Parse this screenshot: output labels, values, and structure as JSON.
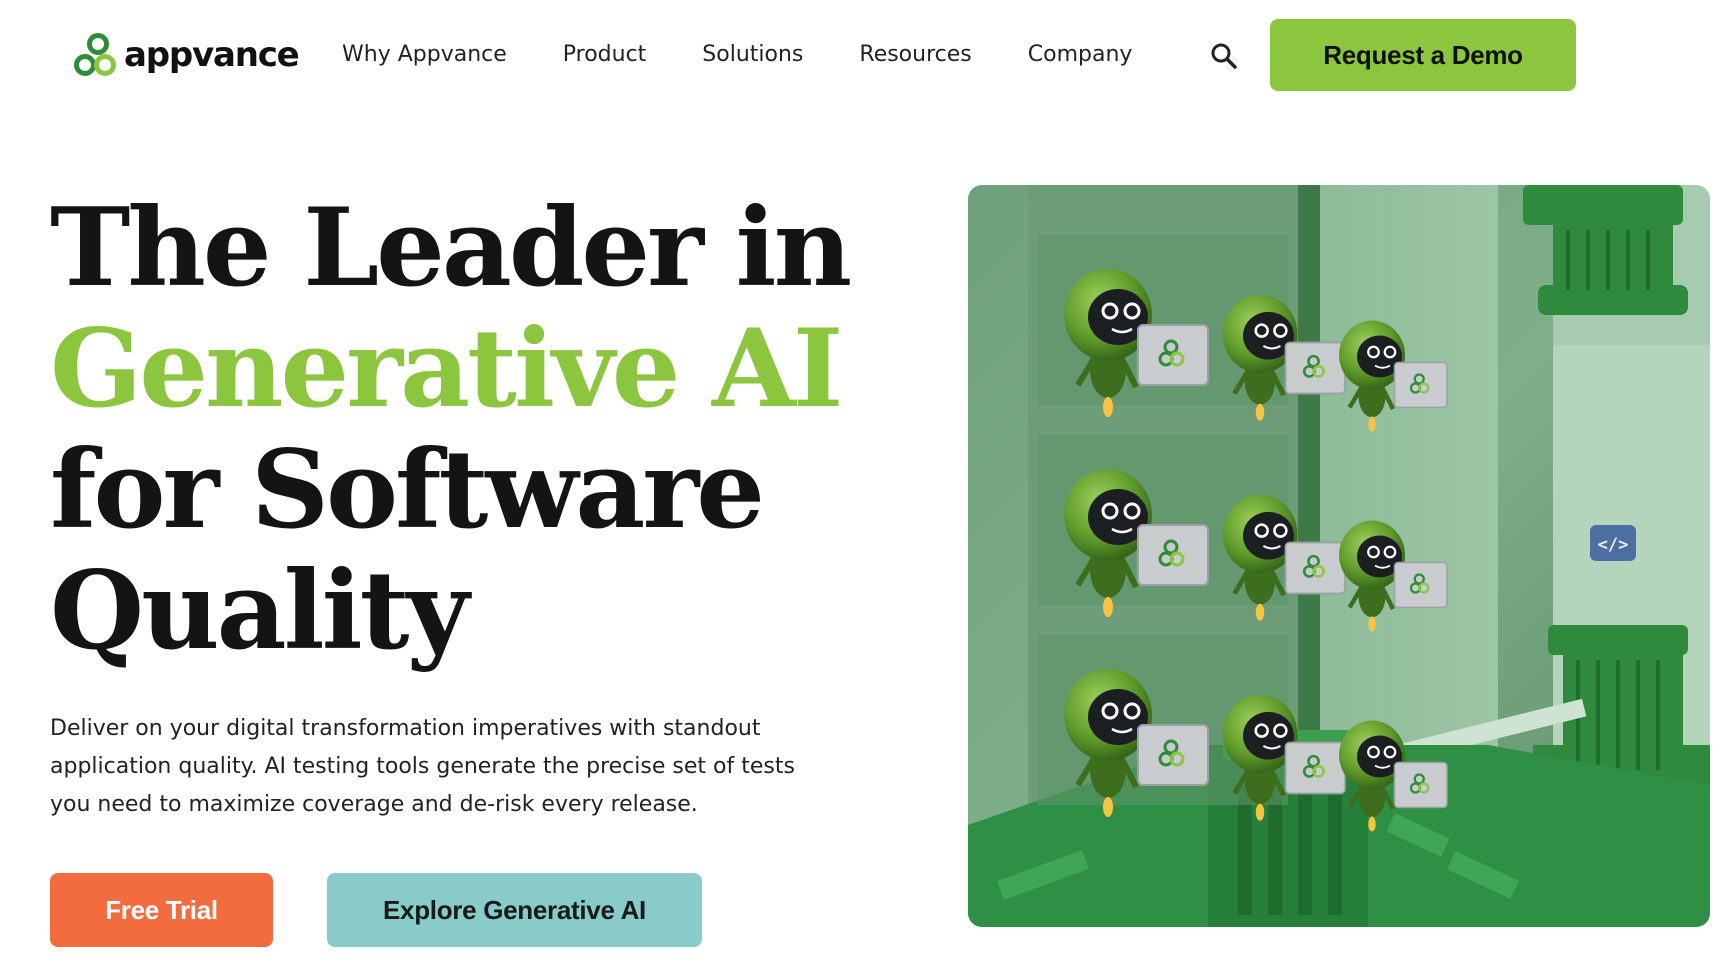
{
  "brand": {
    "name": "appvance",
    "logo_icon": "appvance-knot-logo",
    "colors": {
      "green": "#8cc63f",
      "orange": "#f26c40",
      "teal": "#88cbc8",
      "text": "#141414"
    }
  },
  "nav": {
    "links": [
      "Why Appvance",
      "Product",
      "Solutions",
      "Resources",
      "Company"
    ],
    "search_icon": "search-icon",
    "cta_label": "Request a Demo"
  },
  "hero": {
    "title_line1": "The Leader in",
    "title_line2": "Generative AI",
    "title_line3": "for Software",
    "title_line4": "Quality",
    "description": "Deliver on your digital transformation imperatives with standout application quality. AI testing tools generate the precise set of tests you need to maximize coverage and de-risk every release.",
    "primary_button": "Free Trial",
    "secondary_button": "Explore Generative AI",
    "image_badge_icon": "code-icon"
  }
}
